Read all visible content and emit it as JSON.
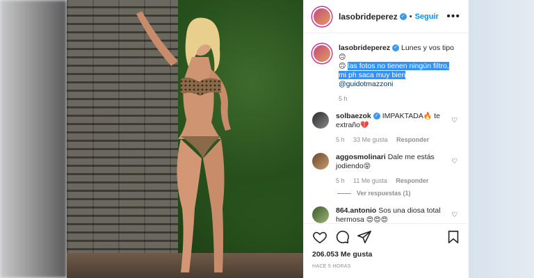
{
  "post": {
    "username": "lasobrideperez",
    "follow_label": "Seguir",
    "more_label": "•••",
    "separator": "•"
  },
  "caption": {
    "username": "lasobrideperez",
    "text_start": "Lunes y vos tipo",
    "emoji_a": "🙃",
    "emoji_b": "🙃",
    "highlight_line1": "las fotos no tienen ningún filtro,",
    "highlight_line2": "mi ph saca muy bien",
    "mention": "@guidotmazzoni",
    "time": "5 h"
  },
  "comments": [
    {
      "username": "solbaezok",
      "verified": true,
      "text": "IMPAKTADA",
      "emoji1": "🔥",
      "text2": "te extraño",
      "emoji2": "💔",
      "time": "5 h",
      "likes": "33 Me gusta",
      "reply": "Responder"
    },
    {
      "username": "aggosmolinari",
      "text": "Dale me estás jodiendo",
      "emoji1": "😝",
      "time": "5 h",
      "likes": "11 Me gusta",
      "reply": "Responder",
      "view_replies": "Ver respuestas (1)"
    },
    {
      "username": "864.antonio",
      "text": "Sos una diosa total hermosa",
      "emoji1": "😍😍😍"
    }
  ],
  "footer": {
    "likes": "206.053 Me gusta",
    "time": "HACE 5 HORAS"
  },
  "icons": {
    "heart": "heart-icon",
    "comment": "comment-icon",
    "share": "share-icon",
    "bookmark": "bookmark-icon",
    "verified": "verified-badge-icon"
  },
  "colors": {
    "accent": "#0095f6",
    "highlight": "#3390ff",
    "verified": "#3897f0",
    "muted": "#8e8e8e"
  }
}
